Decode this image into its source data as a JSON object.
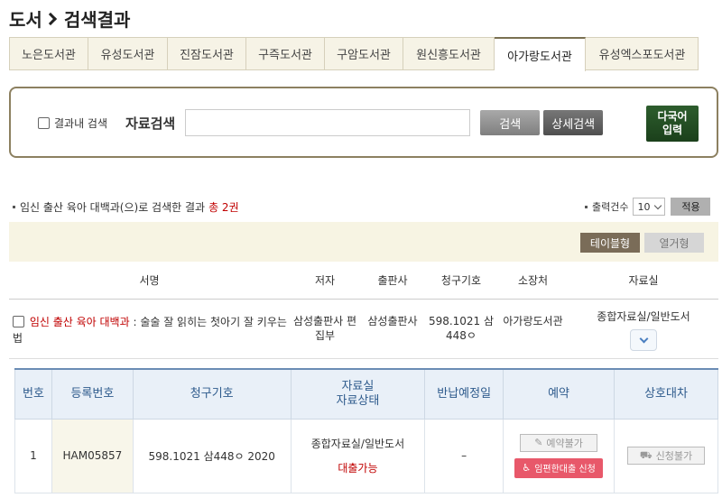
{
  "header": {
    "title_part1": "도서",
    "title_part2": "검색결과"
  },
  "tabs": [
    {
      "label": "노은도서관"
    },
    {
      "label": "유성도서관"
    },
    {
      "label": "진잠도서관"
    },
    {
      "label": "구즉도서관"
    },
    {
      "label": "구암도서관"
    },
    {
      "label": "원신흥도서관"
    },
    {
      "label": "아가랑도서관",
      "active": true
    },
    {
      "label": "유성엑스포도서관"
    }
  ],
  "search": {
    "within_label": "결과내 검색",
    "label": "자료검색",
    "value": "",
    "search_button": "검색",
    "advanced_button": "상세검색",
    "multilang_line1": "다국어",
    "multilang_line2": "입력"
  },
  "summary": {
    "prefix": "임신 출산 육아 대백과(으)로 검색한 결과",
    "count": "총 2권",
    "perpage_label": "출력건수",
    "perpage_value": "10",
    "apply_button": "적용"
  },
  "view": {
    "table_button": "테이블형",
    "column_button": "열거형"
  },
  "results": {
    "headers": [
      "서명",
      "저자",
      "출판사",
      "청구기호",
      "소장처",
      "자료실"
    ],
    "rows": [
      {
        "title_highlight": "임신 출산 육아 대백과",
        "title_rest": " : 술술 잘 읽히는 첫아기 잘 키우는법",
        "author": "삼성출판사 편집부",
        "publisher": "삼성출판사",
        "call_no": "598.1021 삼448ㅇ",
        "location": "아가랑도서관",
        "room": "종합자료실/일반도서"
      }
    ]
  },
  "holdings": {
    "headers": {
      "no": "번호",
      "reg_no": "등록번호",
      "call_no": "청구기호",
      "room_status_1": "자료실",
      "room_status_2": "자료상태",
      "due": "반납예정일",
      "reserve": "예약",
      "ill": "상호대차"
    },
    "rows": [
      {
        "no": "1",
        "reg_no": "HAM05857",
        "call_no": "598.1021 삼448ㅇ 2020",
        "room": "종합자료실/일반도서",
        "status": "대출가능",
        "due": "–",
        "reserve_button": "예약불가",
        "pregnant_button": "임편한대출 신청",
        "ill_button": "신청불가"
      }
    ]
  },
  "colors": {
    "accent_red": "#c00000",
    "tab_bg": "#f6f3e6",
    "holdings_header": "#2d5a8c"
  }
}
